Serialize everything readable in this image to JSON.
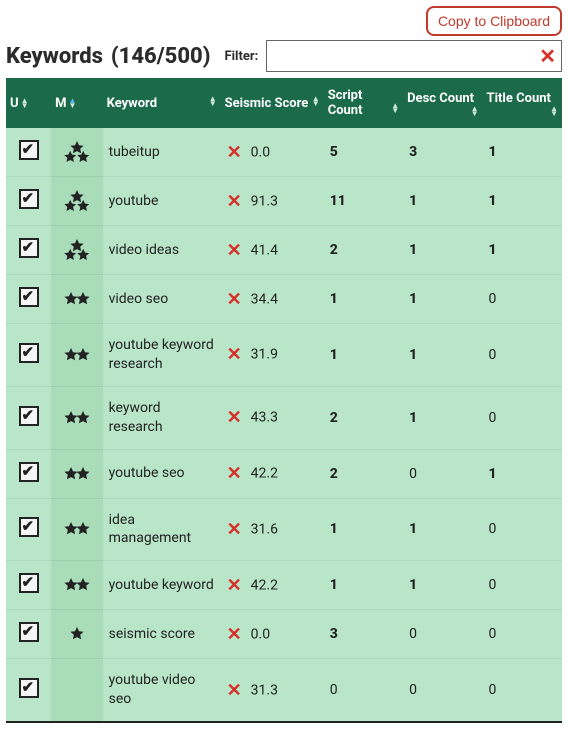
{
  "copy_button": "Copy to Clipboard",
  "title": "Keywords",
  "count_display": "(146/500)",
  "filter_label": "Filter:",
  "filter_value": "",
  "headers": {
    "u": "U",
    "m": "M",
    "keyword": "Keyword",
    "score": "Seismic Score",
    "script": "Script Count",
    "desc": "Desc Count",
    "title": "Title Count"
  },
  "rows": [
    {
      "checked": true,
      "stars": 3,
      "keyword": "tubeitup",
      "score": "0.0",
      "script": "5",
      "script_bold": true,
      "desc": "3",
      "desc_bold": true,
      "title": "1",
      "title_bold": true
    },
    {
      "checked": true,
      "stars": 3,
      "keyword": "youtube",
      "score": "91.3",
      "script": "11",
      "script_bold": true,
      "desc": "1",
      "desc_bold": true,
      "title": "1",
      "title_bold": true
    },
    {
      "checked": true,
      "stars": 3,
      "keyword": "video ideas",
      "score": "41.4",
      "script": "2",
      "script_bold": true,
      "desc": "1",
      "desc_bold": true,
      "title": "1",
      "title_bold": true
    },
    {
      "checked": true,
      "stars": 2,
      "keyword": "video seo",
      "score": "34.4",
      "script": "1",
      "script_bold": true,
      "desc": "1",
      "desc_bold": true,
      "title": "0",
      "title_bold": false
    },
    {
      "checked": true,
      "stars": 2,
      "keyword": "youtube keyword research",
      "score": "31.9",
      "script": "1",
      "script_bold": true,
      "desc": "1",
      "desc_bold": true,
      "title": "0",
      "title_bold": false
    },
    {
      "checked": true,
      "stars": 2,
      "keyword": "keyword research",
      "score": "43.3",
      "script": "2",
      "script_bold": true,
      "desc": "1",
      "desc_bold": true,
      "title": "0",
      "title_bold": false
    },
    {
      "checked": true,
      "stars": 2,
      "keyword": "youtube seo",
      "score": "42.2",
      "script": "2",
      "script_bold": true,
      "desc": "0",
      "desc_bold": false,
      "title": "1",
      "title_bold": true
    },
    {
      "checked": true,
      "stars": 2,
      "keyword": "idea management",
      "score": "31.6",
      "script": "1",
      "script_bold": true,
      "desc": "1",
      "desc_bold": true,
      "title": "0",
      "title_bold": false
    },
    {
      "checked": true,
      "stars": 2,
      "keyword": "youtube keyword",
      "score": "42.2",
      "script": "1",
      "script_bold": true,
      "desc": "1",
      "desc_bold": true,
      "title": "0",
      "title_bold": false
    },
    {
      "checked": true,
      "stars": 1,
      "keyword": "seismic score",
      "score": "0.0",
      "script": "3",
      "script_bold": true,
      "desc": "0",
      "desc_bold": false,
      "title": "0",
      "title_bold": false
    },
    {
      "checked": true,
      "stars": 0,
      "keyword": "youtube video seo",
      "score": "31.3",
      "script": "0",
      "script_bold": false,
      "desc": "0",
      "desc_bold": false,
      "title": "0",
      "title_bold": false
    }
  ]
}
